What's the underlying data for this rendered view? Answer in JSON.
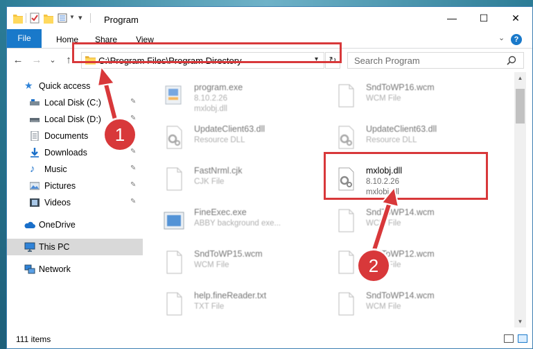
{
  "window": {
    "title": "Program",
    "minimize": "—",
    "maximize": "☐",
    "close": "✕"
  },
  "ribbon": {
    "tabs": [
      "File",
      "Home",
      "Share",
      "View"
    ],
    "help": "?",
    "collapse": "⌄"
  },
  "nav": {
    "back": "←",
    "forward": "→",
    "recent": "⌄",
    "up": "↑",
    "address": "C:\\Program Files\\Program Directory",
    "refresh": "↻",
    "search_placeholder": "Search Program"
  },
  "sidebar": {
    "items": [
      {
        "label": "Quick access",
        "icon": "star-icon"
      },
      {
        "label": "Local Disk (C:)",
        "icon": "drive-icon",
        "pinned": true
      },
      {
        "label": "Local Disk (D:)",
        "icon": "drive-icon",
        "pinned": true
      },
      {
        "label": "Documents",
        "icon": "documents-icon",
        "pinned": true
      },
      {
        "label": "Downloads",
        "icon": "downloads-icon",
        "pinned": true
      },
      {
        "label": "Music",
        "icon": "music-icon",
        "pinned": true
      },
      {
        "label": "Pictures",
        "icon": "pictures-icon",
        "pinned": true
      },
      {
        "label": "Videos",
        "icon": "videos-icon",
        "pinned": true
      },
      {
        "label": "OneDrive",
        "icon": "cloud-icon"
      },
      {
        "label": "This PC",
        "icon": "computer-icon"
      },
      {
        "label": "Network",
        "icon": "network-icon"
      }
    ],
    "pin_glyph": "📌"
  },
  "files": [
    {
      "name": "program.exe",
      "line2": "8.10.2.26",
      "line3": "mxlobj.dll",
      "icon": "exe-icon"
    },
    {
      "name": "SndToWP16.wcm",
      "line2": "WCM File",
      "line3": "",
      "icon": "document-icon"
    },
    {
      "name": "UpdateClient63.dll",
      "line2": "Resource DLL",
      "line3": "",
      "icon": "dll-icon"
    },
    {
      "name": "UpdateClient63.dll",
      "line2": "Resource DLL",
      "line3": "",
      "icon": "dll-icon"
    },
    {
      "name": "FastNrml.cjk",
      "line2": "CJK File",
      "line3": "",
      "icon": "document-icon"
    },
    {
      "name": "mxlobj.dll",
      "line2": "8.10.2.26",
      "line3": "mxlobj.dll",
      "icon": "dll-icon"
    },
    {
      "name": "FineExec.exe",
      "line2": "ABBY background exe...",
      "line3": "",
      "icon": "app-icon"
    },
    {
      "name": "SndToWP14.wcm",
      "line2": "WCM File",
      "line3": "",
      "icon": "document-icon"
    },
    {
      "name": "SndToWP15.wcm",
      "line2": "WCM File",
      "line3": "",
      "icon": "document-icon"
    },
    {
      "name": "SndToWP12.wcm",
      "line2": "WCM File",
      "line3": "",
      "icon": "document-icon"
    },
    {
      "name": "help.fineReader.txt",
      "line2": "TXT File",
      "line3": "",
      "icon": "document-icon"
    },
    {
      "name": "SndToWP14.wcm",
      "line2": "WCM File",
      "line3": "",
      "icon": "document-icon"
    }
  ],
  "status": {
    "item_count": "111 items"
  },
  "callouts": {
    "step1": "1",
    "step2": "2"
  },
  "colors": {
    "accent": "#1979ca",
    "highlight": "#d8383a",
    "selection": "#cce8ff"
  }
}
